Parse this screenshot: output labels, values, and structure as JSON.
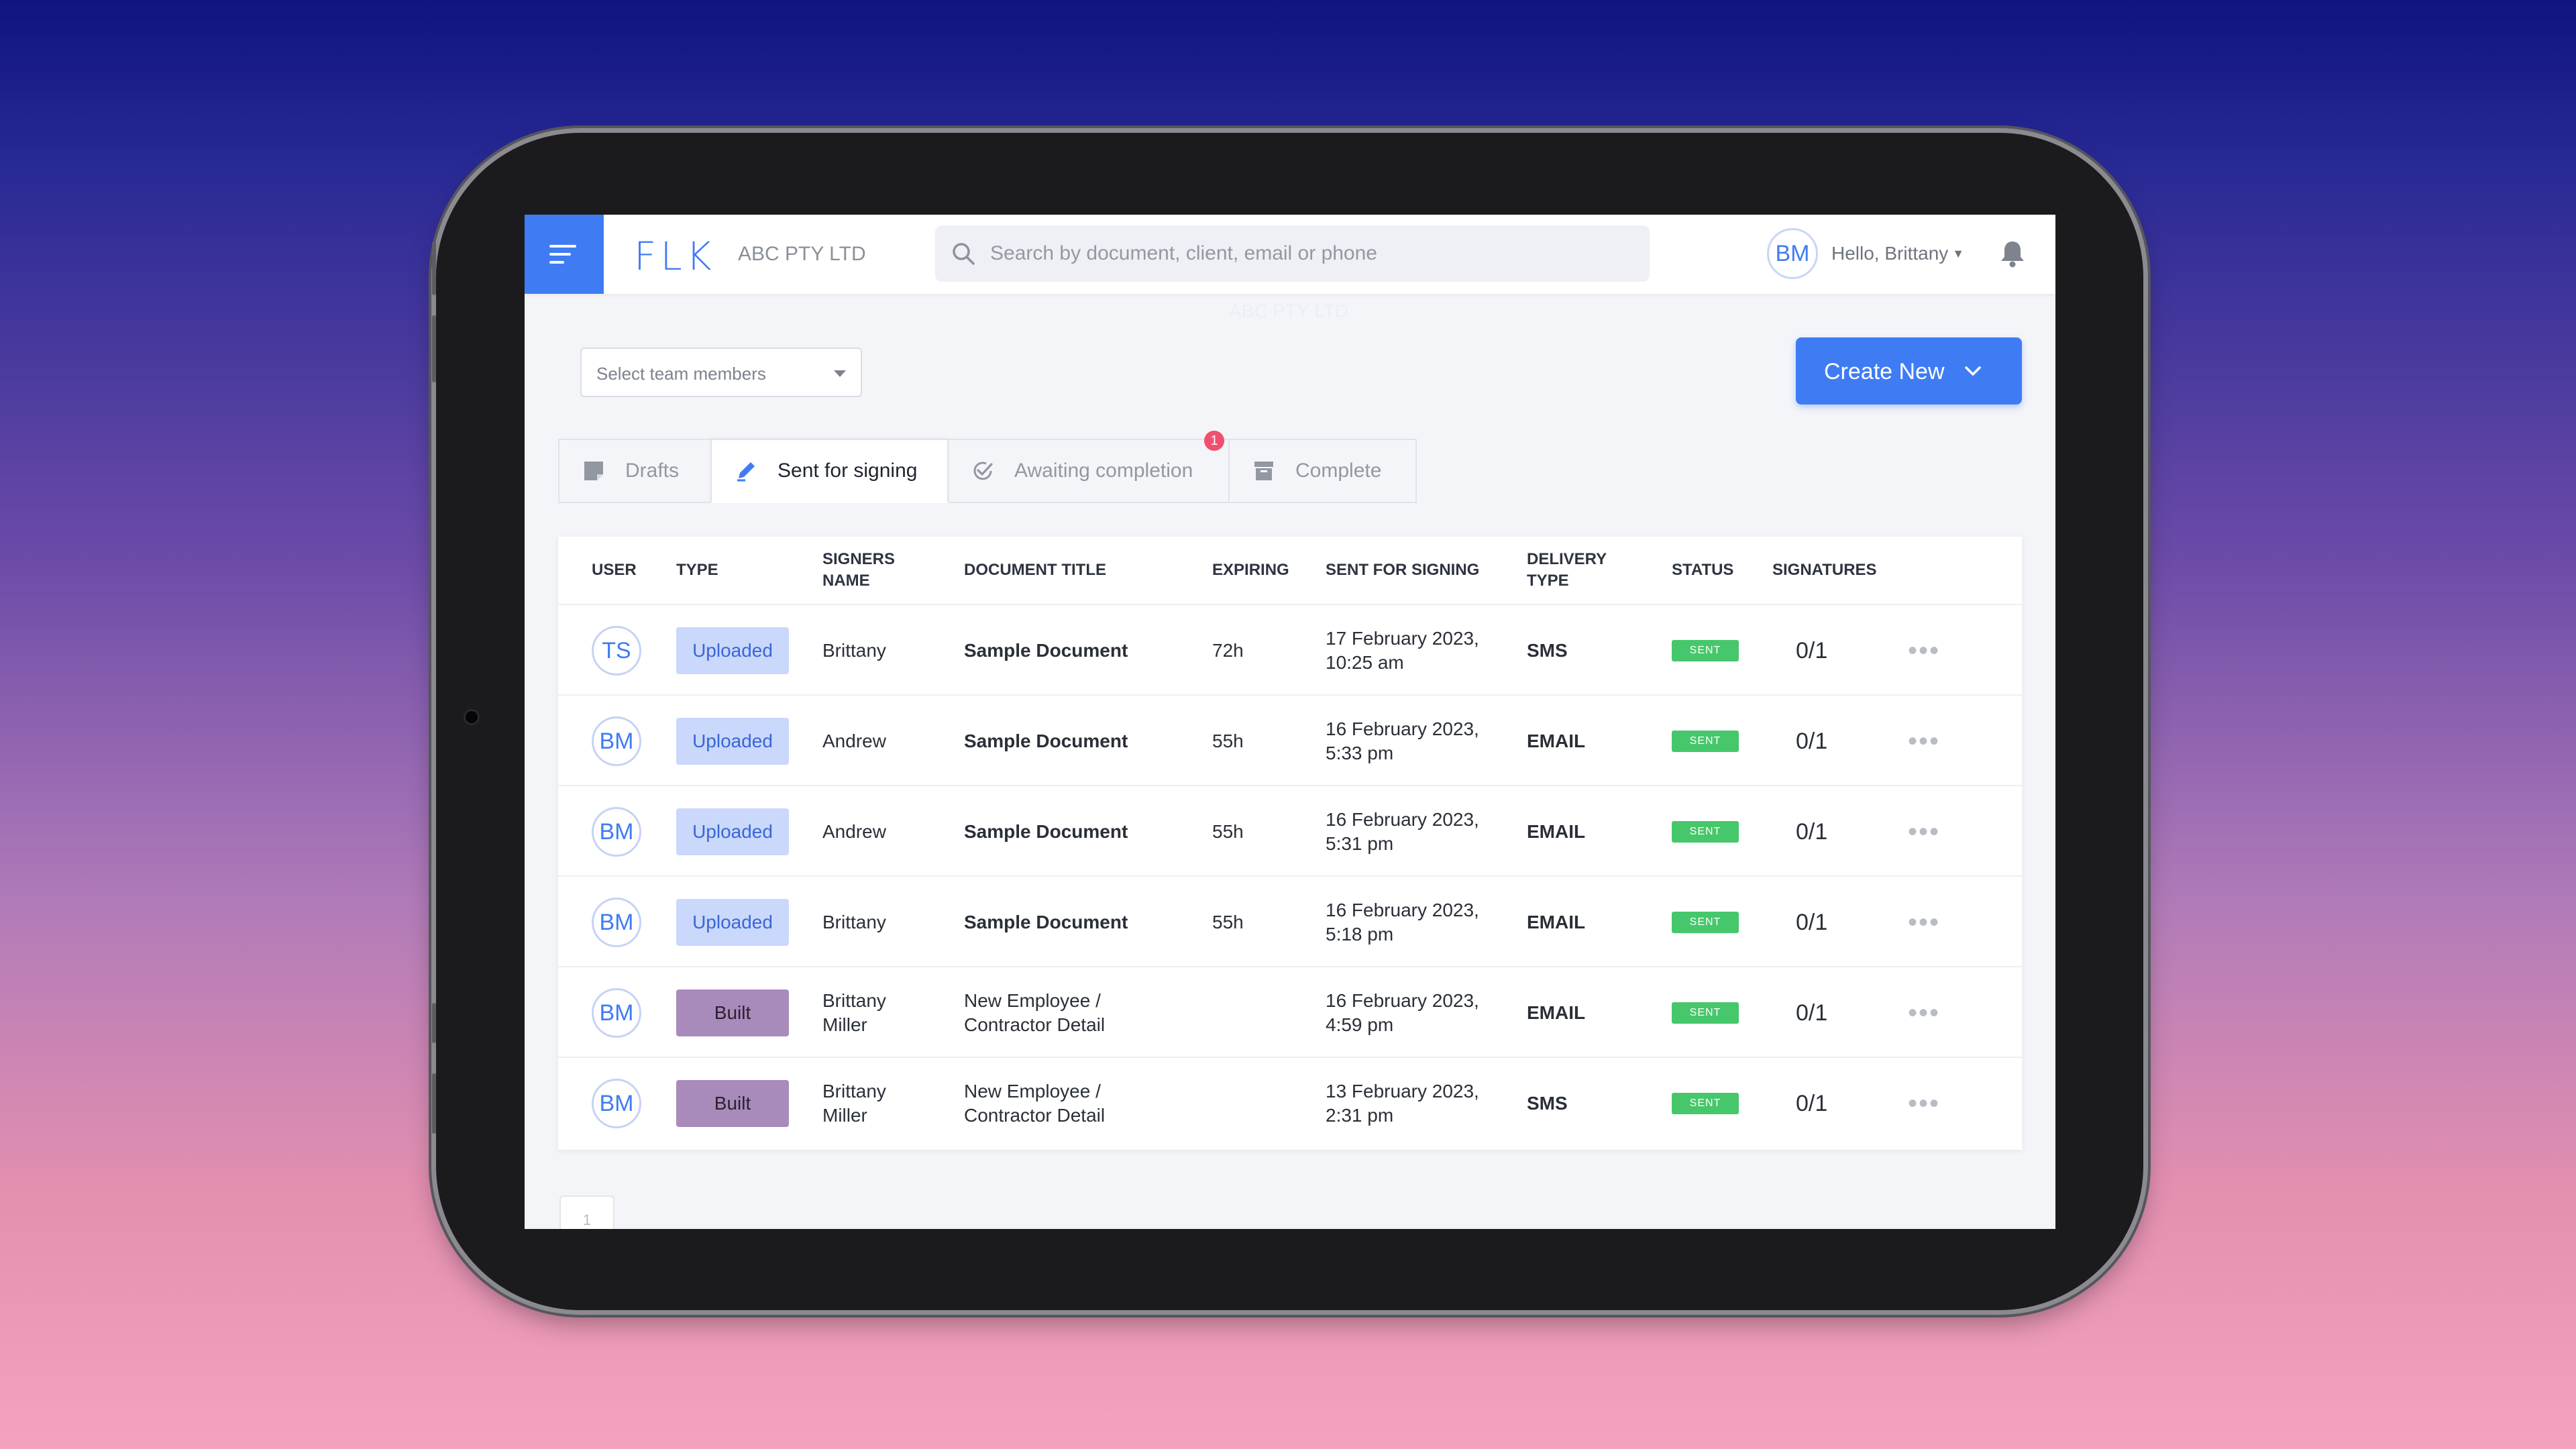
{
  "header": {
    "logo_text": "FLK",
    "company": "ABC PTY LTD",
    "search_placeholder": "Search by document, client, email or phone",
    "user_initials": "BM",
    "greeting": "Hello, Brittany",
    "faded_company": "ABC PTY LTD"
  },
  "filters": {
    "team_select_placeholder": "Select team members"
  },
  "create_button": {
    "label": "Create New"
  },
  "tabs": [
    {
      "label": "Drafts",
      "icon": "draft-icon",
      "active": false
    },
    {
      "label": "Sent for signing",
      "icon": "pen-icon",
      "active": true
    },
    {
      "label": "Awaiting completion",
      "icon": "check-circle-icon",
      "active": false,
      "badge": "1"
    },
    {
      "label": "Complete",
      "icon": "archive-icon",
      "active": false
    }
  ],
  "table": {
    "columns": [
      "USER",
      "TYPE",
      "SIGNERS NAME",
      "DOCUMENT TITLE",
      "EXPIRING",
      "SENT FOR SIGNING",
      "DELIVERY TYPE",
      "STATUS",
      "SIGNATURES"
    ],
    "rows": [
      {
        "user": "TS",
        "type": "Uploaded",
        "signers": "Brittany",
        "document": "Sample Document",
        "expiring": "72h",
        "sent": "17 February 2023, 10:25 am",
        "delivery": "SMS",
        "status": "SENT",
        "signatures": "0/1"
      },
      {
        "user": "BM",
        "type": "Uploaded",
        "signers": "Andrew",
        "document": "Sample Document",
        "expiring": "55h",
        "sent": "16 February 2023, 5:33 pm",
        "delivery": "EMAIL",
        "status": "SENT",
        "signatures": "0/1"
      },
      {
        "user": "BM",
        "type": "Uploaded",
        "signers": "Andrew",
        "document": "Sample Document",
        "expiring": "55h",
        "sent": "16 February 2023, 5:31 pm",
        "delivery": "EMAIL",
        "status": "SENT",
        "signatures": "0/1"
      },
      {
        "user": "BM",
        "type": "Uploaded",
        "signers": "Brittany",
        "document": "Sample Document",
        "expiring": "55h",
        "sent": "16 February 2023, 5:18 pm",
        "delivery": "EMAIL",
        "status": "SENT",
        "signatures": "0/1"
      },
      {
        "user": "BM",
        "type": "Built",
        "signers": "Brittany Miller",
        "document": "New Employee / Contractor Detail",
        "expiring": "",
        "sent": "16 February 2023, 4:59 pm",
        "delivery": "EMAIL",
        "status": "SENT",
        "signatures": "0/1"
      },
      {
        "user": "BM",
        "type": "Built",
        "signers": "Brittany Miller",
        "document": "New Employee / Contractor Detail",
        "expiring": "",
        "sent": "13 February 2023, 2:31 pm",
        "delivery": "SMS",
        "status": "SENT",
        "signatures": "0/1"
      }
    ],
    "row_menu_icon": "more-dots-icon"
  },
  "pagination": {
    "current_page": "1"
  },
  "colors": {
    "accent": "#3f7cf4",
    "uploaded_badge": "#c9d8fb",
    "built_badge": "#a98bbb",
    "status_sent": "#47c76b",
    "notification_badge": "#f0506e"
  }
}
